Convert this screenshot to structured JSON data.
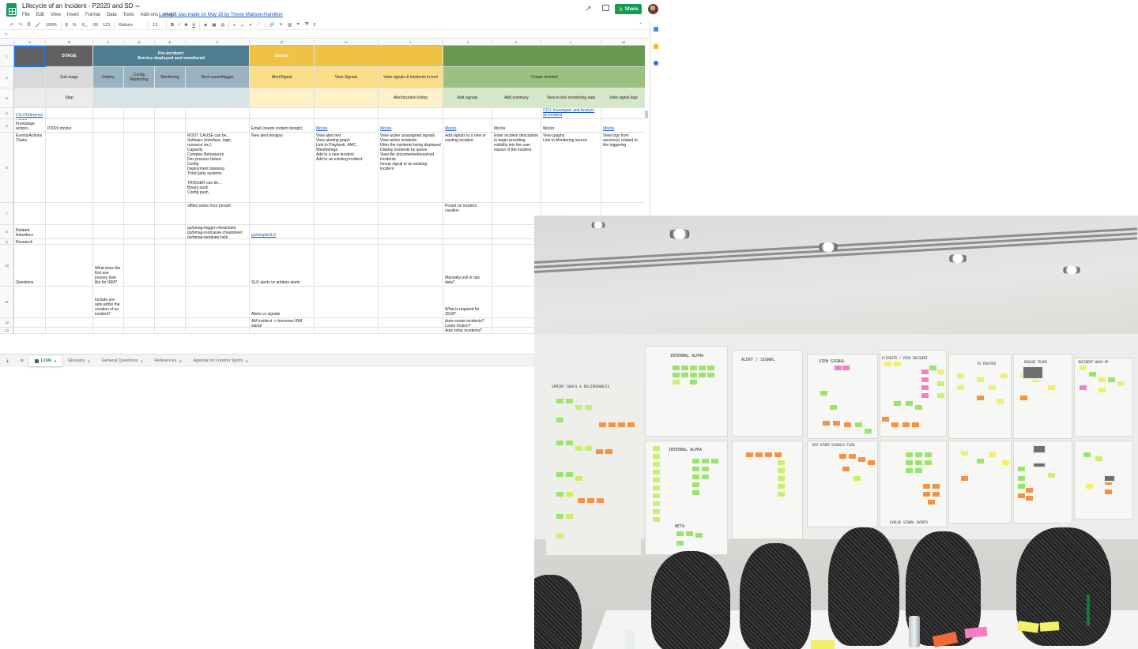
{
  "app": {
    "doc_title": "Lifecycle of an Incident - P2020 and SD",
    "last_edit": "Last edit was made on May 18 by Trevor Mattson-Hamilton",
    "share_label": "Share",
    "menu": [
      "File",
      "Edit",
      "View",
      "Insert",
      "Format",
      "Data",
      "Tools",
      "Add-ons",
      "Help"
    ]
  },
  "toolbar": {
    "zoom": "100%",
    "currency": "$",
    "percent": "%",
    "dec_less": ".0_",
    ".00": ".00",
    "num_format": "123",
    "font": "Roboto",
    "font_size": "12",
    "bold": "B",
    "italic": "I",
    "strike": "S",
    "text_color": "A",
    "sigma": "Σ"
  },
  "formula": {
    "fx": "fx"
  },
  "columns": [
    "A",
    "B",
    "C",
    "D",
    "E",
    "F",
    "G",
    "H",
    "I",
    "J",
    "K",
    "L",
    "M"
  ],
  "rows": [
    "1",
    "2",
    "3",
    "4",
    "5",
    "6",
    "7",
    "8",
    "9",
    "10",
    "11",
    "12",
    "13"
  ],
  "sheet": {
    "r1": {
      "stage": "STAGE",
      "pre_incident": "Pre-incident:\nService deployed and monitored",
      "detect": "Detect"
    },
    "r2": {
      "substage": "Sub-stage",
      "deploy": "Deploy",
      "config_monitoring": "Config Monitoring",
      "monitoring": "Monitoring",
      "root_cause": "Root cause/trigger",
      "alert_signal": "Alert/Signal",
      "view_signals": "View Signals",
      "view_signals_incidents": "View signals & incidents in-tool",
      "create_incident": "Create incident"
    },
    "r3": {
      "step": "Step",
      "alert_listing": "Alert/incident listing",
      "add_signals": "Add signals",
      "add_summary": "Add summary",
      "view_monitoring": "View in-tool monitoring data",
      "view_signal_logs": "View signal logs"
    },
    "r4": {
      "a": "CUJ Reference",
      "l": "CUJ: Investigate and Analyze an incident"
    },
    "r5": {
      "a": "P2020 Frontstage actions",
      "b": "P2020 mocks",
      "g": "Email (needs content design)",
      "h": "Mocks",
      "i": "Mocks",
      "j": "Mocks",
      "k": "Mocks",
      "l": "Mocks",
      "m": "Mocks"
    },
    "r6": {
      "a": "Events/Actions /Tasks",
      "f": "ROOT CAUSE can be...\nSoftware (interface, logic, resource etc.)\nCapacity\nComplex Behaviours\nDev process failure\nConfig\nDeployment planning\nThird party systems\n\nTRIGGER can be...\nBinary push\nConfig push",
      "g": "New alert designs",
      "h": "View alert text\nView alerting graph\nLink to Playbook, AMC, Weatherega\nAdd to a new incident\nAdd to an existing incident",
      "i": "View active unassigned signals\nView active incidents\nFilter the incidents being displayed\nDisplay incidents by queue\nView the documented/resolved incidents\nGroup signal to an existing incident",
      "j": "Add signals to a new or existing incident",
      "k": "Enter incident description to begin providing visibility into the user impact of the incident",
      "l": "View graphs\nLink to Monitoring source",
      "m": "View logs from service(s) related to the triggering"
    },
    "r7": {
      "f": "offline notes from trevarh",
      "j": "Preset on incident creation"
    },
    "r8": {
      "a": "Related links/docs",
      "f": "go/pmag-trigger-cheatsheet\ngo/pmag-rootcause-cheatsheet\ngo/pmag-template-help",
      "g": "go/simpleSLO"
    },
    "r9": {
      "a": "Research"
    },
    "r10": {
      "a": "Questions",
      "c": "What does the first use journey look like for IRM?",
      "g": "SLO alerts vs arbitary alerts",
      "j": "Manually pull in ops data?"
    },
    "r11": {
      "c": "Include pre-sets within the creation of an incident?",
      "g": "Alerts vs signals",
      "j": "What is required for 2018?"
    },
    "r12": {
      "g": "AM incident -> becomes IRM signal",
      "j": "Auto-create incidents?\nLower friction?"
    },
    "r13": {
      "j": "Auto retire incidents?"
    }
  },
  "tabs": [
    "LOAI",
    "Glossary",
    "General Questions",
    "References",
    "Agenda for London Sprint"
  ],
  "photo": {
    "labels": {
      "internal_alpha": "INTERNAL ALPHA",
      "alert_signal": "ALERT / SIGNAL",
      "view_signal": "VIEW SIGNAL",
      "create_view": "P/CREATE / VIEW INCIDENT",
      "sprint_goals": "SPRINT GOALS & DELIVERABLES",
      "internal_alpha_2": "INTERNAL ALPHA",
      "beta": "BETA",
      "to_trusted": "TO TRUSTED",
      "engage_teams": "ENGAGE TEAMS",
      "incident_wrap": "INCIDENT WRAP-UP",
      "dev_other": "DEV OTHER SIGNALS FLOW",
      "evolve": "EVOLVE SIGNAL EVENTS"
    }
  },
  "colors": {
    "stage_dark": "#616161",
    "preincident": "#4e7e92",
    "preincident_light": "#98b3bf",
    "preincident_lighter": "#d8e3e8",
    "detect": "#f0c244",
    "detect_light": "#fadd88",
    "detect_lighter": "#fdf1c8",
    "create": "#6a9a4f",
    "create_light": "#9bc180",
    "create_lighter": "#d6e6c8",
    "grey_hdr": "#c0c0c0",
    "grey_light": "#d9d9d9",
    "grey_lighter": "#ececec",
    "share_green": "#0f9d58"
  }
}
